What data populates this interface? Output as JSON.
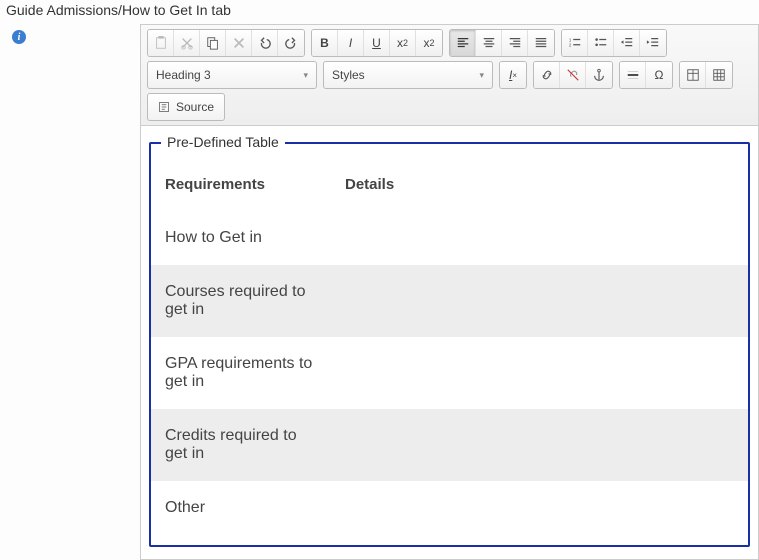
{
  "page_title": "Guide Admissions/How to Get In tab",
  "help_icon_glyph": "i",
  "toolbar": {
    "format_select": "Heading 3",
    "styles_select": "Styles",
    "source_label": "Source"
  },
  "content": {
    "fieldset_legend": "Pre-Defined Table",
    "columns": [
      "Requirements",
      "Details"
    ],
    "rows": [
      {
        "req": "How to Get in",
        "det": ""
      },
      {
        "req": "Courses required to get in",
        "det": ""
      },
      {
        "req": "GPA requirements to get in",
        "det": ""
      },
      {
        "req": "Credits required to get in",
        "det": ""
      },
      {
        "req": "Other",
        "det": ""
      }
    ]
  }
}
